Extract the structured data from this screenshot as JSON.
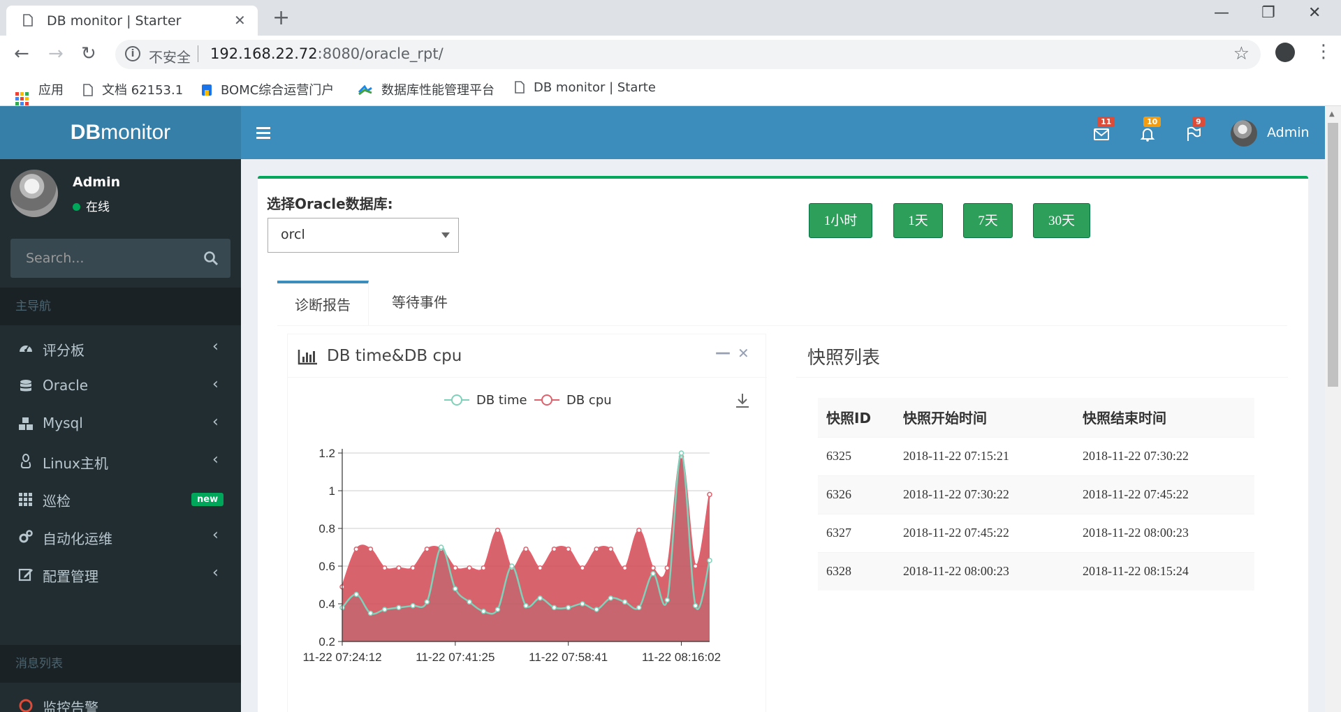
{
  "browser": {
    "tab_title": "DB monitor | Starter",
    "security_label": "不安全",
    "url_host": "192.168.22.72",
    "url_path": ":8080/oracle_rpt/",
    "bookmarks": [
      {
        "label": "应用"
      },
      {
        "label": "文档 62153.1"
      },
      {
        "label": "BOMC综合运营门户"
      },
      {
        "label": "数据库性能管理平台"
      },
      {
        "label": "DB monitor | Starte"
      }
    ]
  },
  "app": {
    "logo_bold": "DB",
    "logo_rest": "monitor",
    "user": {
      "name": "Admin",
      "status": "在线"
    },
    "search_placeholder": "Search...",
    "nav_header_main": "主导航",
    "nav_items": [
      {
        "label": "评分板",
        "icon": "dashboard-icon"
      },
      {
        "label": "Oracle",
        "icon": "database-icon"
      },
      {
        "label": "Mysql",
        "icon": "cubes-icon"
      },
      {
        "label": "Linux主机",
        "icon": "linux-icon"
      },
      {
        "label": "巡检",
        "icon": "grid-icon",
        "badge": "new"
      },
      {
        "label": "自动化运维",
        "icon": "gears-icon"
      },
      {
        "label": "配置管理",
        "icon": "edit-icon"
      }
    ],
    "nav_header_messages": "消息列表",
    "nav_partial": "监控告警",
    "top": {
      "mail_count": "11",
      "bell_count": "10",
      "flag_count": "9",
      "user_name": "Admin",
      "colors": {
        "mail": "#dd4b39",
        "bell": "#f39c12",
        "flag": "#dd4b39"
      }
    }
  },
  "content": {
    "db_label": "选择Oracle数据库:",
    "db_selected": "orcl",
    "range_buttons": [
      "1小时",
      "1天",
      "7天",
      "30天"
    ],
    "tabs": [
      "诊断报告",
      "等待事件"
    ],
    "chart_title": "DB time&DB cpu",
    "snapshot_title": "快照列表",
    "snapshot_columns": [
      "快照ID",
      "快照开始时间",
      "快照结束时间"
    ],
    "snapshot_rows": [
      [
        "6325",
        "2018-11-22 07:15:21",
        "2018-11-22 07:30:22"
      ],
      [
        "6326",
        "2018-11-22 07:30:22",
        "2018-11-22 07:45:22"
      ],
      [
        "6327",
        "2018-11-22 07:45:22",
        "2018-11-22 08:00:23"
      ],
      [
        "6328",
        "2018-11-22 08:00:23",
        "2018-11-22 08:15:24"
      ]
    ]
  },
  "chart_data": {
    "type": "area",
    "title": "",
    "xlabel": "",
    "ylabel": "",
    "ylim": [
      0.2,
      1.2
    ],
    "yticks": [
      "0.2",
      "0.4",
      "0.6",
      "0.8",
      "1",
      "1.2"
    ],
    "xtick_labels": [
      "11-22 07:24:12",
      "11-22 07:41:25",
      "11-22 07:58:41",
      "11-22 08:16:02"
    ],
    "legend_position": "top-center",
    "grid": true,
    "series": [
      {
        "name": "DB time",
        "color": "#7fd1b9",
        "values": [
          0.38,
          0.45,
          0.35,
          0.37,
          0.38,
          0.39,
          0.41,
          0.7,
          0.48,
          0.41,
          0.36,
          0.37,
          0.6,
          0.39,
          0.43,
          0.38,
          0.38,
          0.4,
          0.37,
          0.43,
          0.41,
          0.38,
          0.56,
          0.42,
          1.2,
          0.39,
          0.63
        ]
      },
      {
        "name": "DB cpu",
        "color": "#e0606c",
        "values": [
          0.49,
          0.69,
          0.69,
          0.59,
          0.59,
          0.59,
          0.69,
          0.69,
          0.59,
          0.59,
          0.59,
          0.79,
          0.59,
          0.69,
          0.59,
          0.69,
          0.69,
          0.59,
          0.69,
          0.69,
          0.59,
          0.79,
          0.59,
          0.59,
          1.18,
          0.6,
          0.98
        ]
      }
    ]
  }
}
